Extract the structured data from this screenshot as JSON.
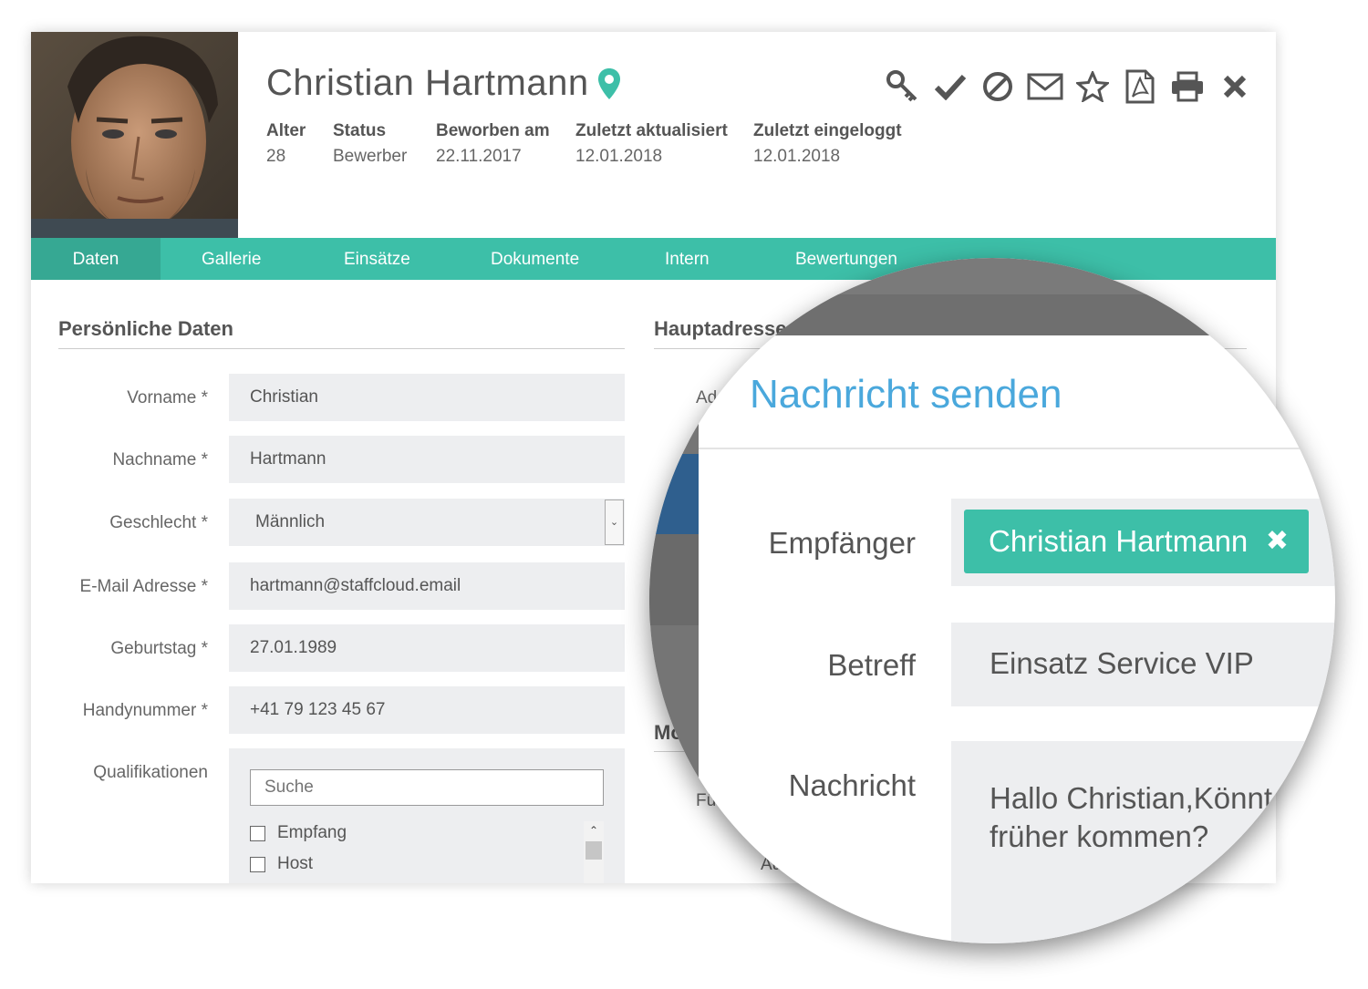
{
  "profile": {
    "name": "Christian Hartmann",
    "meta": [
      {
        "label": "Alter",
        "value": "28"
      },
      {
        "label": "Status",
        "value": "Bewerber"
      },
      {
        "label": "Beworben am",
        "value": "22.11.2017"
      },
      {
        "label": "Zuletzt aktualisiert",
        "value": "12.01.2018"
      },
      {
        "label": "Zuletzt eingeloggt",
        "value": "12.01.2018"
      }
    ]
  },
  "toolbar": {
    "icons": [
      "key-icon",
      "check-icon",
      "block-icon",
      "mail-icon",
      "star-icon",
      "pdf-icon",
      "print-icon",
      "close-icon"
    ]
  },
  "tabs": [
    "Daten",
    "Gallerie",
    "Einsätze",
    "Dokumente",
    "Intern",
    "Bewertungen"
  ],
  "personal": {
    "title": "Persönliche Daten",
    "fields": [
      {
        "label": "Vorname *",
        "value": "Christian"
      },
      {
        "label": "Nachname *",
        "value": "Hartmann"
      },
      {
        "label": "Geschlecht *",
        "value": "Männlich"
      },
      {
        "label": "E-Mail Adresse *",
        "value": "hartmann@staffcloud.email"
      },
      {
        "label": "Geburtstag *",
        "value": "27.01.1989"
      },
      {
        "label": "Handynummer *",
        "value": "+41 79 123 45 67"
      }
    ],
    "qualifications": {
      "label": "Qualifikationen",
      "search_placeholder": "Suche",
      "options": [
        "Empfang",
        "Host"
      ]
    }
  },
  "address": {
    "title": "Hauptadresse",
    "partial_labels": [
      "Ad",
      "Mo",
      "Fü",
      "Au"
    ]
  },
  "modal": {
    "title": "Nachricht senden",
    "recipient_label": "Empfänger",
    "recipient": "Christian Hartmann",
    "subject_label": "Betreff",
    "subject": "Einsatz Service VIP",
    "message_label": "Nachricht",
    "message_line1": "Hallo Christian,Könnt",
    "message_line2": "früher kommen?"
  },
  "colors": {
    "accent": "#3dbfa8",
    "accent_dark": "#36a893",
    "link_blue": "#4aa8dc",
    "pin": "#3dbfa8"
  }
}
